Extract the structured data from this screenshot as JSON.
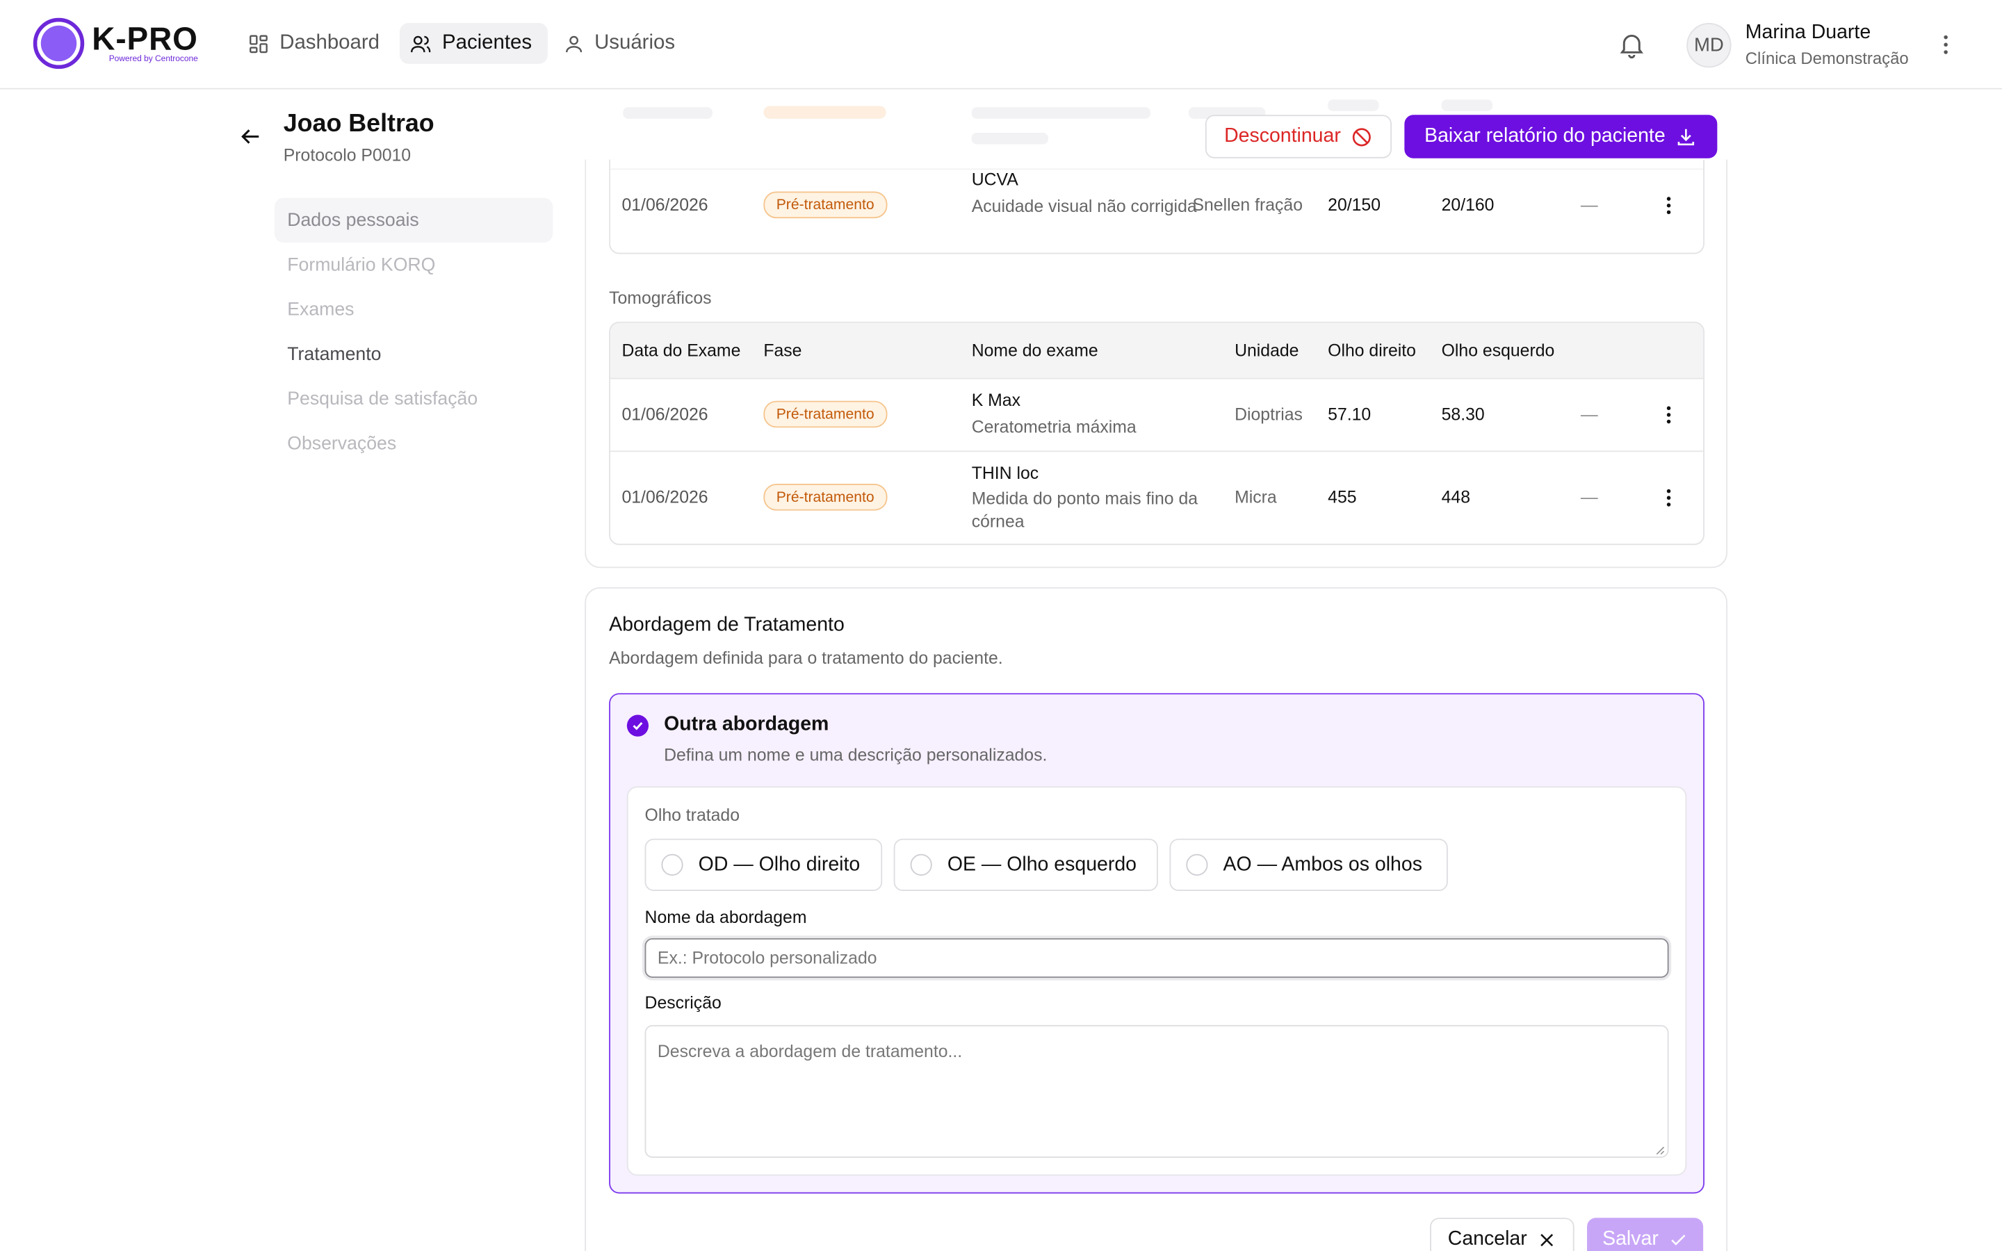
{
  "app": {
    "logo_name": "K-PRO",
    "logo_sub": "Powered by Centrocone",
    "brand_color": "#6d0fe0"
  },
  "nav": {
    "items": [
      {
        "label": "Dashboard",
        "icon": "dashboard-grid-icon"
      },
      {
        "label": "Pacientes",
        "icon": "users-icon",
        "active": true
      },
      {
        "label": "Usuários",
        "icon": "user-icon"
      }
    ]
  },
  "user": {
    "initials": "MD",
    "name": "Marina Duarte",
    "org": "Clínica Demonstração"
  },
  "patient": {
    "name": "Joao Beltrao",
    "protocol": "Protocolo P0010"
  },
  "actions": {
    "discontinue": "Descontinuar",
    "report": "Baixar relatório do paciente"
  },
  "sidebar": {
    "items": [
      {
        "label": "Dados pessoais"
      },
      {
        "label": "Formulário KORQ"
      },
      {
        "label": "Exames"
      },
      {
        "label": "Tratamento"
      },
      {
        "label": "Pesquisa de satisfação"
      },
      {
        "label": "Observações"
      }
    ]
  },
  "visual_table": {
    "row": {
      "date": "01/06/2026",
      "phase": "Pré-tratamento",
      "exam_name": "UCVA",
      "exam_desc": "Acuidade visual não corrigida",
      "unit": "Snellen fração",
      "od": "20/150",
      "oe": "20/160",
      "extra": "—"
    }
  },
  "tomo": {
    "label": "Tomográficos",
    "headers": {
      "date": "Data do Exame",
      "phase": "Fase",
      "exam": "Nome do exame",
      "unit": "Unidade",
      "od": "Olho direito",
      "oe": "Olho esquerdo"
    },
    "rows": [
      {
        "date": "01/06/2026",
        "phase": "Pré-tratamento",
        "exam_name": "K Max",
        "exam_desc": "Ceratometria máxima",
        "unit": "Dioptrias",
        "od": "57.10",
        "oe": "58.30",
        "extra": "—"
      },
      {
        "date": "01/06/2026",
        "phase": "Pré-tratamento",
        "exam_name": "THIN loc",
        "exam_desc": "Medida do ponto mais fino da córnea",
        "unit": "Micra",
        "od": "455",
        "oe": "448",
        "extra": "—"
      }
    ]
  },
  "approach": {
    "title": "Abordagem de Tratamento",
    "subtitle": "Abordagem definida para o tratamento do paciente.",
    "option_title": "Outra abordagem",
    "option_sub": "Defina um nome e uma descrição personalizados.",
    "eye_label": "Olho tratado",
    "eyes": [
      "OD — Olho direito",
      "OE — Olho esquerdo",
      "AO — Ambos os olhos"
    ],
    "name_label": "Nome da abordagem",
    "name_placeholder": "Ex.: Protocolo personalizado",
    "name_value": "",
    "desc_label": "Descrição",
    "desc_placeholder": "Descreva a abordagem de tratamento...",
    "desc_value": "",
    "cancel": "Cancelar",
    "save": "Salvar"
  }
}
